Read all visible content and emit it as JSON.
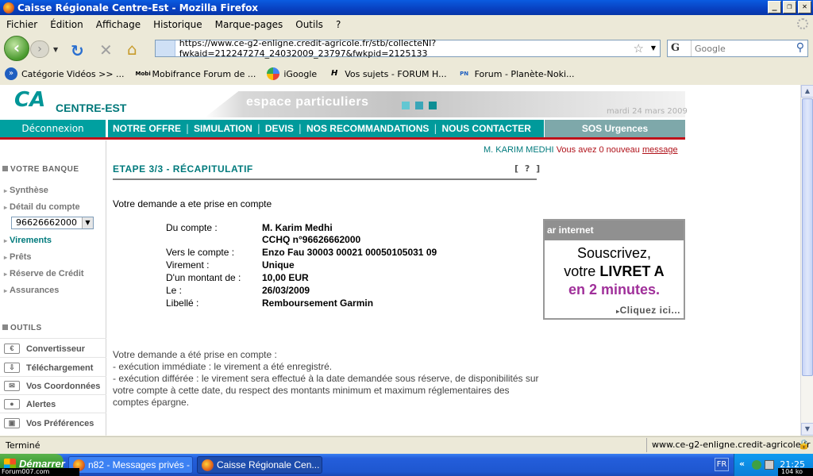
{
  "window": {
    "title": "Caisse Régionale Centre-Est - Mozilla Firefox"
  },
  "menubar": [
    "Fichier",
    "Édition",
    "Affichage",
    "Historique",
    "Marque-pages",
    "Outils",
    "?"
  ],
  "nav": {
    "url": "https://www.ce-g2-enligne.credit-agricole.fr/stb/collecteNI?fwkaid=212247274_24032009_23797&fwkpid=2125133",
    "search_placeholder": "Google",
    "search_engine": "G"
  },
  "bookmarks": [
    "Catégorie Vidéos >> ...",
    "Mobifrance Forum de ...",
    "iGoogle",
    "Vos sujets - FORUM H...",
    "Forum - Planète-Noki..."
  ],
  "bookmark_icons": [
    "Mobi",
    "PN"
  ],
  "header": {
    "logo_mark": "CA",
    "brand": "CENTRE-EST",
    "banner": "espace particuliers",
    "date": "mardi 24 mars 2009",
    "banner_colors": [
      "#62c7d2",
      "#3aa6b8",
      "#0e8e94"
    ]
  },
  "topnav": {
    "logout": "Déconnexion",
    "items": [
      "NOTRE OFFRE",
      "SIMULATION",
      "DEVIS",
      "NOS RECOMMANDATIONS",
      "NOUS CONTACTER"
    ],
    "sos": "SOS Urgences",
    "separator": "|"
  },
  "user": {
    "name": "M. KARIM MEDHI",
    "message_prefix": "Vous avez 0 nouveau",
    "message_link": "message"
  },
  "sidebar": {
    "section1": "VOTRE BANQUE",
    "items": [
      "Synthèse",
      "Détail du compte",
      "Virements",
      "Prêts",
      "Réserve de Crédit",
      "Assurances"
    ],
    "account_select": "96626662000",
    "section2": "OUTILS",
    "tools": [
      {
        "label": "Convertisseur",
        "icon": "€"
      },
      {
        "label": "Téléchargement",
        "icon": "⇩"
      },
      {
        "label": "Vos Coordonnées",
        "icon": "✉"
      },
      {
        "label": "Alertes",
        "icon": "●"
      },
      {
        "label": "Vos Préférences",
        "icon": "▣"
      }
    ]
  },
  "main": {
    "step_title": "ETAPE 3/3 - RÉCAPITULATIF",
    "help": "[ ? ]",
    "confirmation": "Votre demande a ete prise en compte",
    "details": [
      {
        "label": "Du compte :",
        "value": "M. Karim Medhi"
      },
      {
        "label": "",
        "value": "CCHQ n°96626662000"
      },
      {
        "label": "Vers le compte :",
        "value": "Enzo Fau 30003 00021 00050105031 09"
      },
      {
        "label": "Virement :",
        "value": "Unique"
      },
      {
        "label": "D'un montant de :",
        "value": "10,00 EUR"
      },
      {
        "label": "Le :",
        "value": "26/03/2009"
      },
      {
        "label": "Libellé :",
        "value": "Remboursement Garmin"
      }
    ],
    "notes": [
      "Votre demande a été prise en compte :",
      "- exécution immédiate : le virement a été enregistré.",
      "- exécution différée : le virement sera effectué à la date demandée sous réserve, de disponibilités sur votre compte à cette date, du respect des montants minimum et maximum réglementaires des",
      "comptes épargne."
    ]
  },
  "ad": {
    "header": "ar internet",
    "line1": "Souscrivez,",
    "line2_prefix": "votre",
    "line2_bold": "LIVRET A",
    "line3": "en 2 minutes.",
    "cta": "Cliquez ici..."
  },
  "status": {
    "text": "Terminé",
    "url": "www.ce-g2-enligne.credit-agricole.fr"
  },
  "taskbar": {
    "start": "Démarrer",
    "tasks": [
      "n82 - Messages privés - ...",
      "Caisse Régionale Cen..."
    ],
    "lang": "FR",
    "clock": "21:25",
    "tray_arrows": "«",
    "watermark_left": "Forum007.com",
    "watermark_right": "104 ko"
  }
}
